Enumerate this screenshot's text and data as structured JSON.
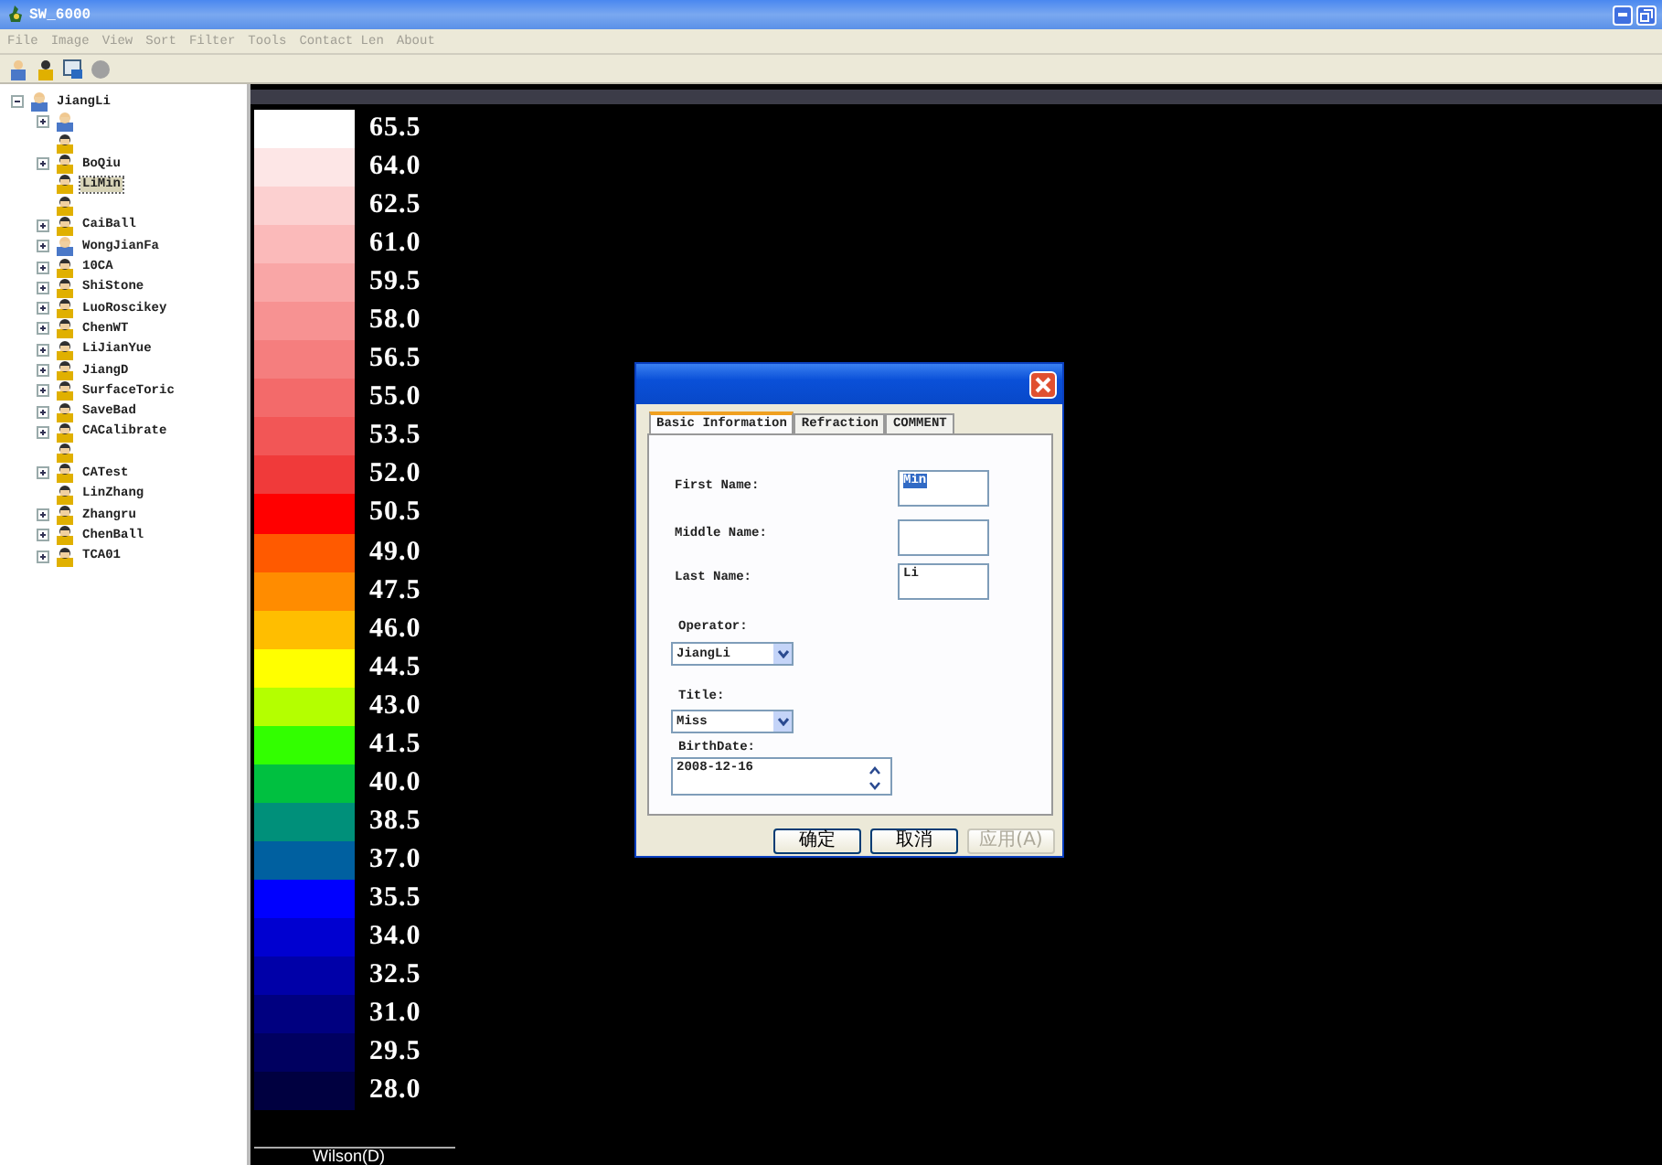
{
  "window": {
    "title": "SW_6000"
  },
  "menu": [
    {
      "label": "File",
      "disabled": true
    },
    {
      "label": "Image",
      "disabled": true
    },
    {
      "label": "View",
      "disabled": true
    },
    {
      "label": "Sort",
      "disabled": true
    },
    {
      "label": "Filter",
      "disabled": true
    },
    {
      "label": "Tools",
      "disabled": true
    },
    {
      "label": "Contact Len",
      "disabled": true
    },
    {
      "label": "About",
      "disabled": true
    }
  ],
  "tree": {
    "label": "JiangLi",
    "kind": "operator",
    "expanded": true,
    "children": [
      {
        "kind": "operator",
        "expandable": true,
        "selected": false
      },
      {
        "kind": "patient",
        "expandable": false,
        "selected": false
      },
      {
        "label": "BoQiu",
        "kind": "patient",
        "expandable": true,
        "selected": false
      },
      {
        "label": "LiMin",
        "kind": "patient",
        "expandable": false,
        "selected": true
      },
      {
        "kind": "patient",
        "expandable": false,
        "selected": false
      },
      {
        "label": "CaiBall",
        "kind": "patient",
        "expandable": true,
        "selected": false
      },
      {
        "label": "WongJianFa",
        "kind": "operator",
        "expandable": true,
        "selected": false
      },
      {
        "label": "10CA",
        "kind": "patient",
        "expandable": true,
        "selected": false
      },
      {
        "label": "ShiStone",
        "kind": "patient",
        "expandable": true,
        "selected": false
      },
      {
        "label": "LuoRoscikey",
        "kind": "patient",
        "expandable": true,
        "selected": false
      },
      {
        "label": "ChenWT",
        "kind": "patient",
        "expandable": true,
        "selected": false
      },
      {
        "label": "LiJianYue",
        "kind": "patient",
        "expandable": true,
        "selected": false
      },
      {
        "label": "JiangD",
        "kind": "patient",
        "expandable": true,
        "selected": false
      },
      {
        "label": "SurfaceToric",
        "kind": "patient",
        "expandable": true,
        "selected": false
      },
      {
        "label": "SaveBad",
        "kind": "patient",
        "expandable": true,
        "selected": false
      },
      {
        "label": "CACalibrate",
        "kind": "patient",
        "expandable": true,
        "selected": false
      },
      {
        "kind": "patient",
        "expandable": false,
        "selected": false
      },
      {
        "label": "CATest",
        "kind": "patient",
        "expandable": true,
        "selected": false
      },
      {
        "label": "LinZhang",
        "kind": "patient",
        "expandable": false,
        "selected": false
      },
      {
        "label": "Zhangru",
        "kind": "patient",
        "expandable": true,
        "selected": false
      },
      {
        "label": "ChenBall",
        "kind": "patient",
        "expandable": true,
        "selected": false
      },
      {
        "label": "TCA01",
        "kind": "patient",
        "expandable": true,
        "selected": false
      }
    ]
  },
  "scale": [
    {
      "value": "65.5",
      "color": "#ffffff"
    },
    {
      "value": "64.0",
      "color": "#fde6e6"
    },
    {
      "value": "62.5",
      "color": "#fcd0d0"
    },
    {
      "value": "61.0",
      "color": "#fbbaba"
    },
    {
      "value": "59.5",
      "color": "#f9a6a6"
    },
    {
      "value": "58.0",
      "color": "#f79292"
    },
    {
      "value": "56.5",
      "color": "#f57e7e"
    },
    {
      "value": "55.0",
      "color": "#f36a6a"
    },
    {
      "value": "53.5",
      "color": "#f25656"
    },
    {
      "value": "52.0",
      "color": "#f03a3a"
    },
    {
      "value": "50.5",
      "color": "#ff0000"
    },
    {
      "value": "49.0",
      "color": "#ff5a00"
    },
    {
      "value": "47.5",
      "color": "#ff8c00"
    },
    {
      "value": "46.0",
      "color": "#ffbe00"
    },
    {
      "value": "44.5",
      "color": "#ffff00"
    },
    {
      "value": "43.0",
      "color": "#b4ff00"
    },
    {
      "value": "41.5",
      "color": "#32ff00"
    },
    {
      "value": "40.0",
      "color": "#00c040"
    },
    {
      "value": "38.5",
      "color": "#00907a"
    },
    {
      "value": "37.0",
      "color": "#0060a0"
    },
    {
      "value": "35.5",
      "color": "#0000ff"
    },
    {
      "value": "34.0",
      "color": "#0000d0"
    },
    {
      "value": "32.5",
      "color": "#0000a8"
    },
    {
      "value": "31.0",
      "color": "#000080"
    },
    {
      "value": "29.5",
      "color": "#000060"
    },
    {
      "value": "28.0",
      "color": "#000040"
    }
  ],
  "scale_caption": "Wilson(D)",
  "dialog": {
    "tabs": [
      {
        "label": "Basic Information",
        "selected": true
      },
      {
        "label": "Refraction",
        "selected": false
      },
      {
        "label": "COMMENT",
        "selected": false
      }
    ],
    "first_name": {
      "label": "First Name:",
      "value": "Min",
      "highlighted": true
    },
    "middle_name": {
      "label": "Middle Name:"
    },
    "last_name": {
      "label": "Last Name:",
      "value": "Li",
      "highlighted": false
    },
    "operator": {
      "label": "Operator:",
      "value": "JiangLi"
    },
    "title": {
      "label": "Title:",
      "value": "Miss"
    },
    "birthdate": {
      "label": "BirthDate:",
      "value": "2008-12-16"
    },
    "buttons": [
      {
        "label": "确定",
        "disabled": false
      },
      {
        "label": "取消",
        "disabled": false
      },
      {
        "label": "应用(A)",
        "disabled": true
      }
    ]
  }
}
